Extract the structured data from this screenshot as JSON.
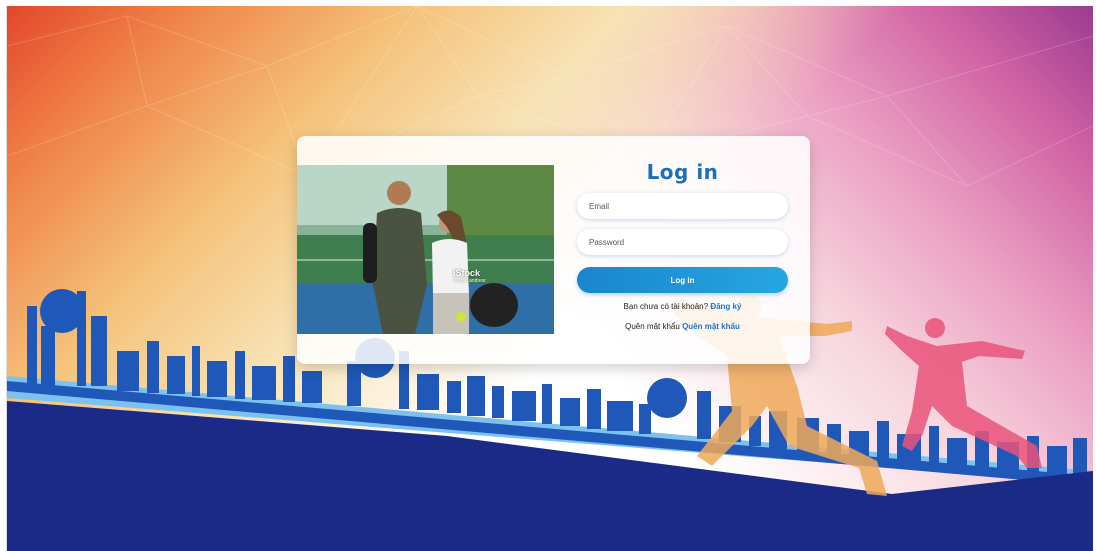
{
  "login": {
    "title": "Log in",
    "email_placeholder": "Email",
    "password_placeholder": "Password",
    "submit_label": "Log in",
    "register_prompt": "Bạn chưa có tài khoản?",
    "register_link": "Đăng ký",
    "forgot_prompt": "Quên mật khẩu",
    "forgot_link": "Quên mật khẩu"
  },
  "photo": {
    "watermark_brand": "iStock",
    "watermark_credit": "Credit: andresr"
  },
  "colors": {
    "title_blue": "#1d6fb8",
    "button_blue": "#1a85cf",
    "link_blue": "#1d74c4",
    "skyline_blue": "#1f58b8",
    "ground_navy": "#1a2a86"
  }
}
